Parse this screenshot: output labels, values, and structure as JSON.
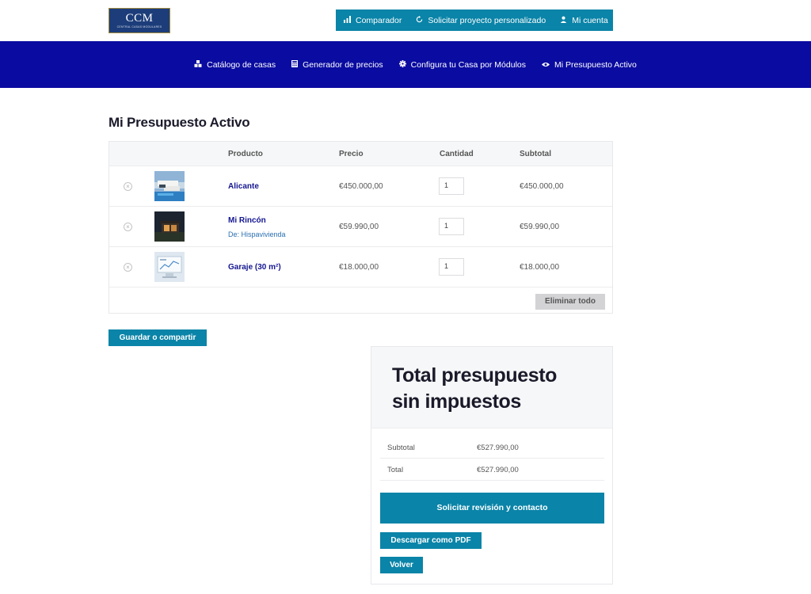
{
  "logo": {
    "main": "CCM",
    "sub": "CENTRAL CASAS MODULARES"
  },
  "topnav": {
    "items": [
      {
        "label": "Comparador",
        "icon": "bar-chart-icon"
      },
      {
        "label": "Solicitar proyecto personalizado",
        "icon": "refresh-icon"
      },
      {
        "label": "Mi cuenta",
        "icon": "user-icon"
      }
    ]
  },
  "mainnav": {
    "items": [
      {
        "label": "Catálogo de casas",
        "icon": "cubes-icon"
      },
      {
        "label": "Generador de precios",
        "icon": "calculator-icon"
      },
      {
        "label": "Configura tu Casa por Módulos",
        "icon": "gear-icon"
      },
      {
        "label": "Mi Presupuesto Activo",
        "icon": "eye-icon"
      }
    ]
  },
  "page": {
    "title": "Mi Presupuesto Activo"
  },
  "cart": {
    "headers": {
      "product": "Producto",
      "price": "Precio",
      "quantity": "Cantidad",
      "subtotal": "Subtotal"
    },
    "rows": [
      {
        "product": "Alicante",
        "vendor_prefix": "",
        "vendor": "",
        "price": "€450.000,00",
        "qty": "1",
        "subtotal": "€450.000,00"
      },
      {
        "product": "Mi Rincón",
        "vendor_prefix": "De:",
        "vendor": "Hispavivienda",
        "price": "€59.990,00",
        "qty": "1",
        "subtotal": "€59.990,00"
      },
      {
        "product": "Garaje (30 m²)",
        "vendor_prefix": "",
        "vendor": "",
        "price": "€18.000,00",
        "qty": "1",
        "subtotal": "€18.000,00"
      }
    ],
    "clear_label": "Eliminar todo",
    "remove_symbol": "×"
  },
  "save_label": "Guardar o compartir",
  "totals": {
    "title": "Total presupuesto sin impuestos",
    "subtotal_label": "Subtotal",
    "subtotal_value": "€527.990,00",
    "total_label": "Total",
    "total_value": "€527.990,00",
    "review_label": "Solicitar revisión y contacto",
    "pdf_label": "Descargar como PDF",
    "back_label": "Volver"
  },
  "colors": {
    "accent": "#0a84a8",
    "nav": "#0a0ba0",
    "link": "#141690"
  }
}
